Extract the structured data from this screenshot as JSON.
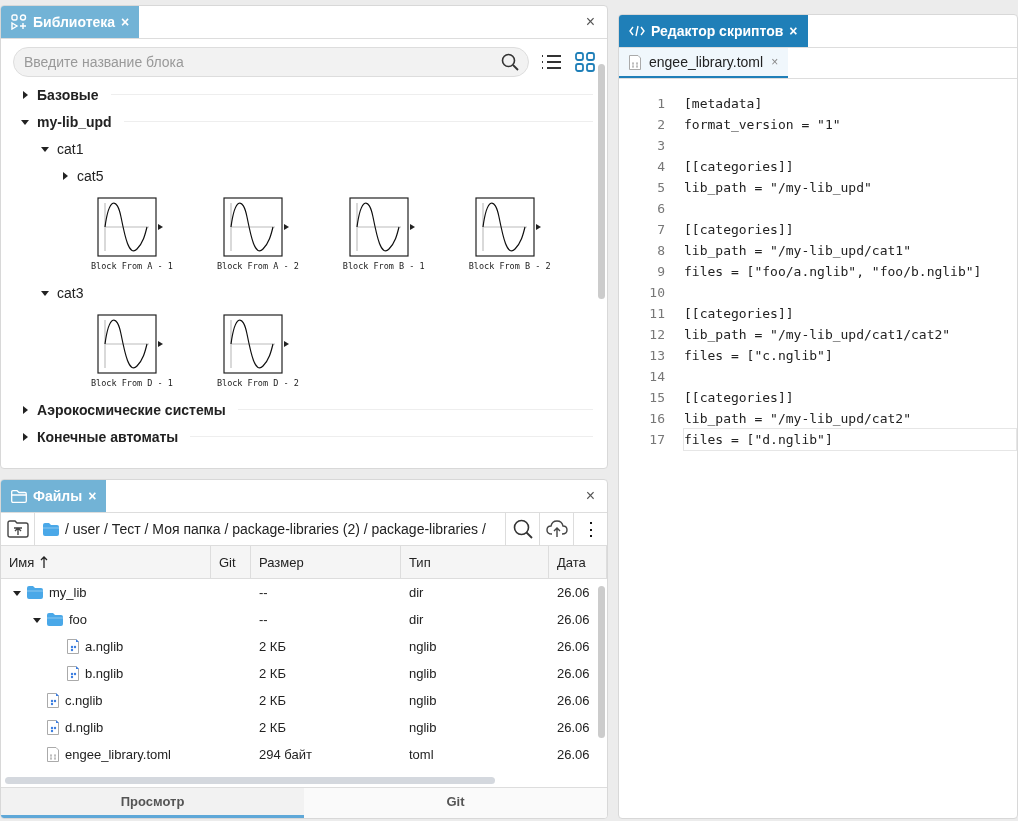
{
  "library": {
    "tab": {
      "title": "Библиотека",
      "close": "×"
    },
    "panel_close": "×",
    "search": {
      "placeholder": "Введите название блока"
    },
    "view_modes": [
      {
        "kind": "list",
        "selected": false
      },
      {
        "kind": "grid",
        "selected": true
      }
    ],
    "tree": [
      {
        "label": "Базовые",
        "expanded": false
      },
      {
        "label": "my-lib_upd",
        "expanded": true,
        "children": [
          {
            "label": "cat1",
            "expanded": true,
            "children": [
              {
                "label": "cat5",
                "expanded": false
              }
            ],
            "blocks": [
              "Block From A - 1",
              "Block From A - 2",
              "Block From B - 1",
              "Block From B - 2"
            ]
          },
          {
            "label": "cat3",
            "expanded": true,
            "blocks": [
              "Block From D - 1",
              "Block From D - 2"
            ]
          }
        ]
      },
      {
        "label": "Аэрокосмические системы",
        "expanded": false
      },
      {
        "label": "Конечные автоматы",
        "expanded": false
      }
    ]
  },
  "files": {
    "tab": {
      "title": "Файлы",
      "close": "×"
    },
    "panel_close": "×",
    "path": "/ user / Тест / Моя папка / package-libraries (2) / package-libraries /",
    "menu": "⋮",
    "columns": [
      {
        "label": "Имя",
        "sorted": true
      },
      {
        "label": "Git",
        "sorted": false
      },
      {
        "label": "Размер",
        "sorted": false
      },
      {
        "label": "Тип",
        "sorted": false
      },
      {
        "label": "Дата",
        "sorted": false
      }
    ],
    "rows": [
      {
        "name": "my_lib",
        "kind": "folder",
        "expanded": true,
        "size": "--",
        "type": "dir",
        "date": "26.06",
        "children": [
          {
            "name": "foo",
            "kind": "folder",
            "expanded": true,
            "size": "--",
            "type": "dir",
            "date": "26.06",
            "children": [
              {
                "name": "a.nglib",
                "kind": "nglib",
                "size": "2 КБ",
                "type": "nglib",
                "date": "26.06"
              },
              {
                "name": "b.nglib",
                "kind": "nglib",
                "size": "2 КБ",
                "type": "nglib",
                "date": "26.06"
              }
            ]
          },
          {
            "name": "c.nglib",
            "kind": "nglib",
            "size": "2 КБ",
            "type": "nglib",
            "date": "26.06"
          },
          {
            "name": "d.nglib",
            "kind": "nglib",
            "size": "2 КБ",
            "type": "nglib",
            "date": "26.06"
          },
          {
            "name": "engee_library.toml",
            "kind": "toml",
            "size": "294 байт",
            "type": "toml",
            "date": "26.06"
          }
        ]
      }
    ],
    "bottom_tabs": [
      {
        "label": "Просмотр",
        "selected": true
      },
      {
        "label": "Git",
        "selected": false
      }
    ]
  },
  "editor": {
    "tab": {
      "title": "Редактор скриптов",
      "close": "×"
    },
    "file_tab": {
      "name": "engee_library.toml",
      "close": "×",
      "selected": true
    },
    "lines": [
      {
        "number": "1",
        "text": "[metadata]",
        "current": false
      },
      {
        "number": "2",
        "text": "format_version = \"1\"",
        "current": false
      },
      {
        "number": "3",
        "current": false
      },
      {
        "number": "4",
        "text": "[[categories]]",
        "current": false
      },
      {
        "number": "5",
        "text": "lib_path = \"/my-lib_upd\"",
        "current": false
      },
      {
        "number": "6",
        "current": false
      },
      {
        "number": "7",
        "text": "[[categories]]",
        "current": false
      },
      {
        "number": "8",
        "text": "lib_path = \"/my-lib_upd/cat1\"",
        "current": false
      },
      {
        "number": "9",
        "text": "files = [\"foo/a.nglib\", \"foo/b.nglib\"]",
        "current": false
      },
      {
        "number": "10",
        "current": false
      },
      {
        "number": "11",
        "text": "[[categories]]",
        "current": false
      },
      {
        "number": "12",
        "text": "lib_path = \"/my-lib_upd/cat1/cat2\"",
        "current": false
      },
      {
        "number": "13",
        "text": "files = [\"c.nglib\"]",
        "current": false
      },
      {
        "number": "14",
        "current": false
      },
      {
        "number": "15",
        "text": "[[categories]]",
        "current": false
      },
      {
        "number": "16",
        "text": "lib_path = \"/my-lib_upd/cat2\"",
        "current": false
      },
      {
        "number": "17",
        "text": "files = [\"d.nglib\"]",
        "current": true
      }
    ]
  }
}
